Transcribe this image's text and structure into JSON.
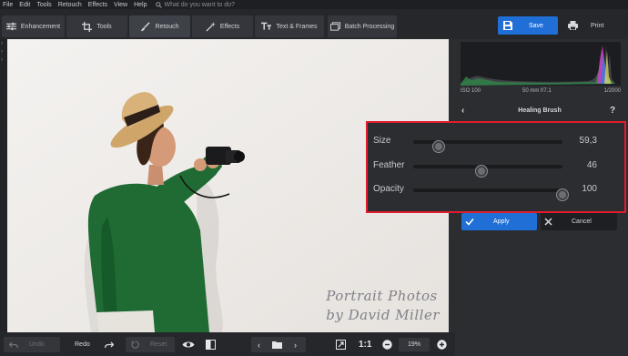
{
  "menu": [
    "File",
    "Edit",
    "Tools",
    "Retouch",
    "Effects",
    "View",
    "Help"
  ],
  "search": {
    "placeholder": "What do you want to do?"
  },
  "tabs": [
    {
      "label": "Enhancement",
      "icon": "sliders-icon"
    },
    {
      "label": "Tools",
      "icon": "crop-icon"
    },
    {
      "label": "Retouch",
      "icon": "brush-icon",
      "active": true
    },
    {
      "label": "Effects",
      "icon": "magic-icon"
    },
    {
      "label": "Text & Frames",
      "icon": "text-icon"
    },
    {
      "label": "Batch Processing",
      "icon": "batch-icon"
    }
  ],
  "actions": {
    "save": "Save",
    "print": "Print"
  },
  "exif": {
    "iso": "ISO 100",
    "lens": "50 mm f/7.1",
    "shutter": "1/2000"
  },
  "panel": {
    "title": "Healing Brush"
  },
  "sliders": [
    {
      "label": "Size",
      "value": "59,3",
      "position": 0.17
    },
    {
      "label": "Feather",
      "value": "46",
      "position": 0.46
    },
    {
      "label": "Opacity",
      "value": "100",
      "position": 1.0
    }
  ],
  "buttons": {
    "apply": "Apply",
    "cancel": "Cancel"
  },
  "bottom": {
    "undo": "Undo",
    "redo": "Redo",
    "reset": "Reset",
    "zoom_label": "1:1",
    "zoom": "19%"
  },
  "watermark": {
    "line1": "Portrait Photos",
    "line2": "by David Miller"
  },
  "colors": {
    "accent": "#1f6fd6",
    "highlight_border": "#e21c2c",
    "background": "#2b2d31"
  }
}
